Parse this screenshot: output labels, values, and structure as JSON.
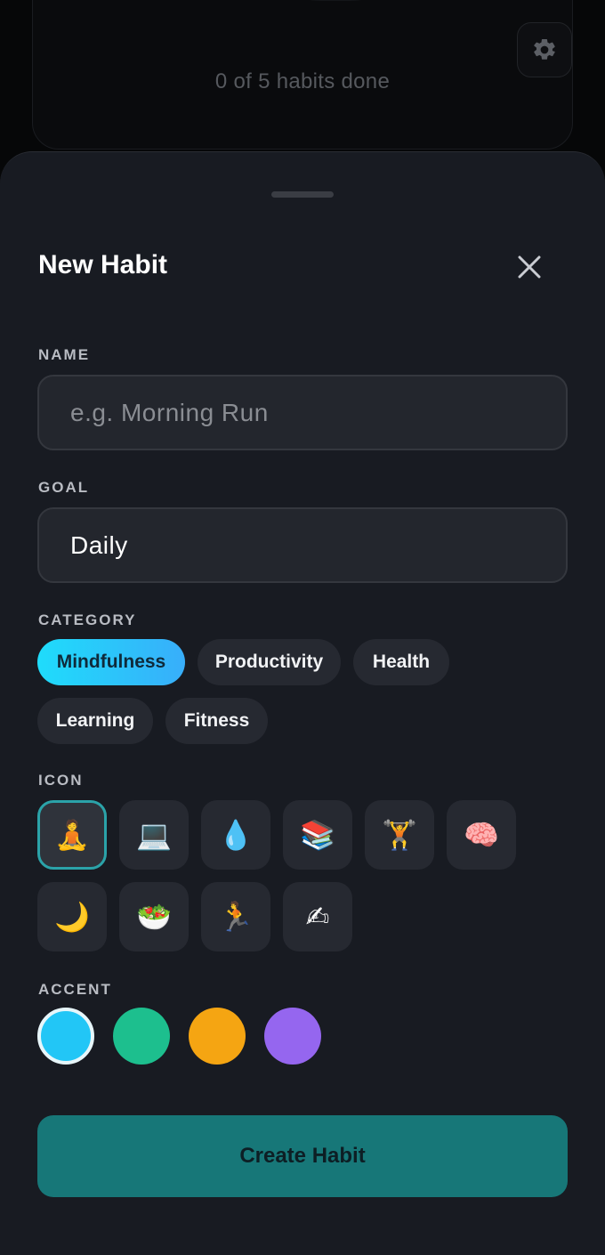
{
  "background": {
    "progress_text": "0 of 5 habits done",
    "settings_icon": "gear-icon"
  },
  "sheet": {
    "title": "New Habit",
    "close_icon": "close-icon"
  },
  "form": {
    "name": {
      "label": "NAME",
      "placeholder": "e.g. Morning Run",
      "value": ""
    },
    "goal": {
      "label": "GOAL",
      "value": "Daily"
    },
    "category": {
      "label": "CATEGORY",
      "selected": "Mindfulness",
      "options": [
        "Mindfulness",
        "Productivity",
        "Health",
        "Learning",
        "Fitness"
      ]
    },
    "icon": {
      "label": "ICON",
      "selected_index": 0,
      "options": [
        {
          "glyph": "🧘",
          "name": "meditation-icon"
        },
        {
          "glyph": "💻",
          "name": "laptop-icon"
        },
        {
          "glyph": "💧",
          "name": "droplet-icon"
        },
        {
          "glyph": "📚",
          "name": "books-icon"
        },
        {
          "glyph": "🏋",
          "name": "weightlifter-icon"
        },
        {
          "glyph": "🧠",
          "name": "brain-icon"
        },
        {
          "glyph": "🌙",
          "name": "moon-icon"
        },
        {
          "glyph": "🥗",
          "name": "salad-icon"
        },
        {
          "glyph": "🏃",
          "name": "runner-icon"
        },
        {
          "glyph": "✍",
          "name": "writing-hand-icon"
        }
      ]
    },
    "accent": {
      "label": "ACCENT",
      "selected_index": 0,
      "colors": [
        "#22c6f6",
        "#1dbf8e",
        "#f5a512",
        "#9566ef"
      ]
    },
    "submit_label": "Create Habit"
  }
}
